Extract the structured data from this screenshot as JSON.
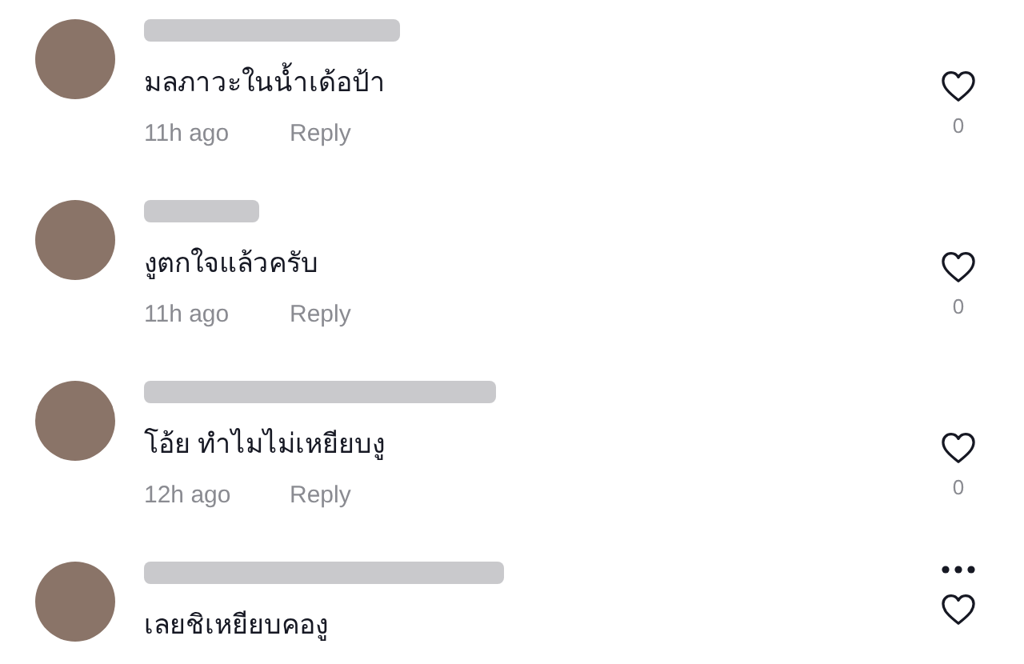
{
  "comments": [
    {
      "text": "มลภาวะในน้ำเด้อป้า",
      "time": "11h ago",
      "reply": "Reply",
      "likes": "0",
      "liked": false,
      "more_menu": false
    },
    {
      "text": "งูตกใจแล้วครับ",
      "time": "11h ago",
      "reply": "Reply",
      "likes": "0",
      "liked": false,
      "more_menu": false
    },
    {
      "text": "โอ้ย ทำไมไม่เหยียบงู",
      "time": "12h ago",
      "reply": "Reply",
      "likes": "0",
      "liked": false,
      "more_menu": false
    },
    {
      "text": "เลยชิเหยียบคองู",
      "liked": false,
      "more_menu": true
    }
  ]
}
